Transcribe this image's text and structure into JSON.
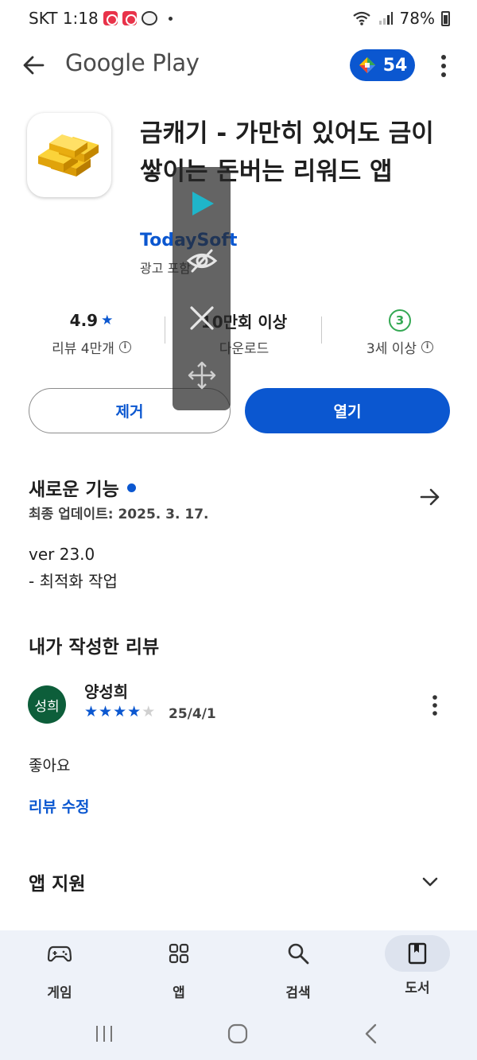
{
  "status_bar": {
    "carrier_time": "SKT 1:18",
    "battery": "78%"
  },
  "top_bar": {
    "title": "Google Play",
    "points": "54"
  },
  "app": {
    "title": "금캐기 - 가만히 있어도 금이 쌓이는 돈버는 리워드 앱",
    "developer": "TodaySoft",
    "ad_note": "광고 포함"
  },
  "stats": {
    "rating": "4.9",
    "rating_label": "리뷰 4만개",
    "downloads": "10만회 이상",
    "downloads_label": "다운로드",
    "age_badge": "3",
    "age_label": "3세 이상"
  },
  "actions": {
    "remove": "제거",
    "open": "열기"
  },
  "whats_new": {
    "title": "새로운 기능",
    "updated": "최종 업데이트: 2025. 3. 17.",
    "version": "ver 23.0",
    "note": "- 최적화 작업"
  },
  "my_review": {
    "title": "내가 작성한 리뷰",
    "avatar_text": "성희",
    "reviewer": "양성희",
    "rating": 4,
    "max_rating": 5,
    "date": "25/4/1",
    "text": "좋아요",
    "edit_label": "리뷰 수정"
  },
  "app_support": {
    "title": "앱 지원"
  },
  "bottom_nav": [
    {
      "label": "게임",
      "icon": "gamepad-icon"
    },
    {
      "label": "앱",
      "icon": "apps-grid-icon"
    },
    {
      "label": "검색",
      "icon": "search-icon"
    },
    {
      "label": "도서",
      "icon": "book-icon",
      "active": true
    }
  ],
  "colors": {
    "accent": "#0b57d0",
    "avatar_bg": "#0d5e3a",
    "age_green": "#34a853",
    "nav_bg": "#eef2f9"
  }
}
